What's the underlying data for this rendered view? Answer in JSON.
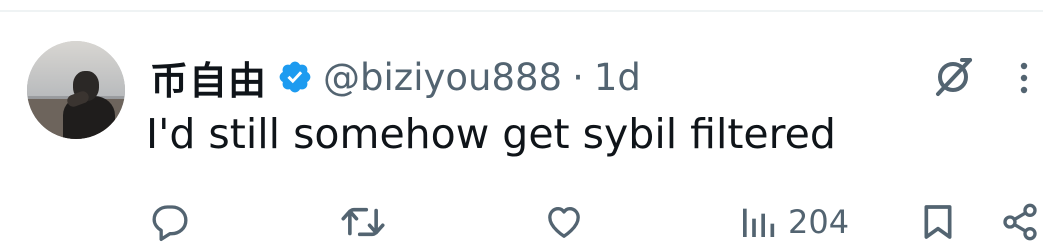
{
  "tweet": {
    "author": {
      "display_name": "币自由",
      "handle": "@biziyou888",
      "verified": true
    },
    "separator": "·",
    "timestamp": "1d",
    "text": "I'd still somehow get sybil filtered"
  },
  "actions": {
    "reply": {
      "icon": "reply-icon"
    },
    "retweet": {
      "icon": "retweet-icon"
    },
    "like": {
      "icon": "heart-icon"
    },
    "views": {
      "icon": "views-icon",
      "count": "204"
    },
    "bookmark": {
      "icon": "bookmark-icon"
    },
    "share": {
      "icon": "share-icon"
    }
  },
  "colors": {
    "text_primary": "#0f1419",
    "text_secondary": "#536471",
    "verified_blue": "#1d9bf0",
    "divider": "#eff3f4"
  }
}
